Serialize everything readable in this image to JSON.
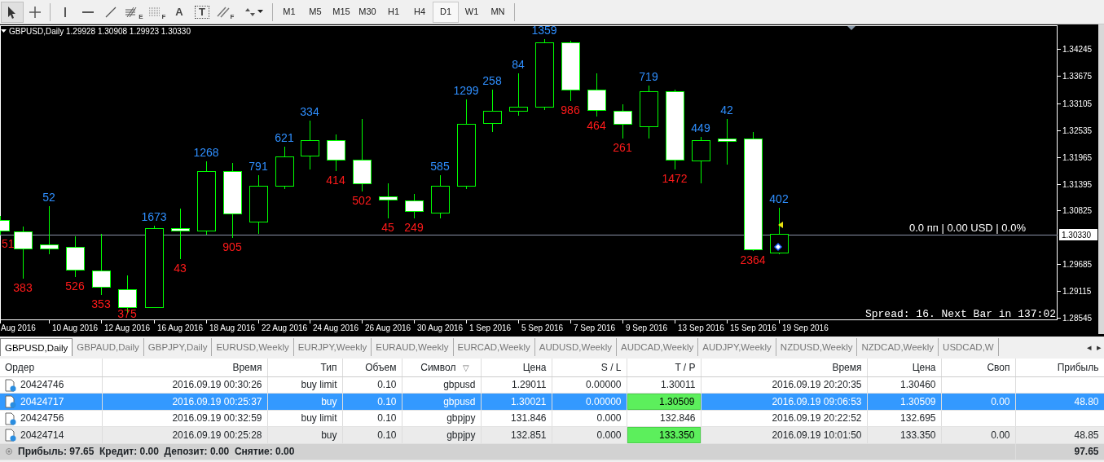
{
  "toolbar": {
    "tools": [
      {
        "kind": "cursor",
        "selected": true
      },
      {
        "kind": "crosshair",
        "selected": false
      },
      {
        "kind": "vline",
        "selected": false
      },
      {
        "kind": "hline",
        "selected": false
      },
      {
        "kind": "trendline",
        "selected": false
      },
      {
        "kind": "fibo",
        "glyph": "E",
        "selected": false
      },
      {
        "kind": "dotted",
        "glyph": "F",
        "selected": false
      },
      {
        "kind": "letter",
        "glyph": "A",
        "selected": false
      },
      {
        "kind": "boxed",
        "glyph": "T",
        "selected": false
      },
      {
        "kind": "parallel",
        "glyph": "F",
        "selected": false
      },
      {
        "kind": "arrows",
        "selected": false
      }
    ],
    "timeframes": [
      {
        "label": "M1",
        "selected": false
      },
      {
        "label": "M5",
        "selected": false
      },
      {
        "label": "M15",
        "selected": false
      },
      {
        "label": "M30",
        "selected": false
      },
      {
        "label": "H1",
        "selected": false
      },
      {
        "label": "H4",
        "selected": false
      },
      {
        "label": "D1",
        "selected": true
      },
      {
        "label": "W1",
        "selected": false
      },
      {
        "label": "MN",
        "selected": false
      }
    ]
  },
  "chart": {
    "symbol": "GBPUSD,Daily",
    "ohlc": "1.29928 1.30908 1.29923 1.30330",
    "candles": [
      {
        "kind": "bear",
        "label": "51",
        "label_above": false,
        "date": "Aug 2016"
      },
      {
        "kind": "bear",
        "label": "383",
        "label_above": false
      },
      {
        "kind": "bear",
        "label": "52",
        "label_above": true,
        "date": "10 Aug 2016"
      },
      {
        "kind": "bear",
        "label": "526",
        "label_above": false
      },
      {
        "kind": "bear",
        "label": "353",
        "label_above": false,
        "date": "12 Aug 2016"
      },
      {
        "kind": "bear",
        "label": "375",
        "label_above": false
      },
      {
        "kind": "bull",
        "label": "1673",
        "label_above": true,
        "date": "16 Aug 2016"
      },
      {
        "kind": "bear",
        "label": "43",
        "label_above": false
      },
      {
        "kind": "bull",
        "label": "1268",
        "label_above": true,
        "date": "18 Aug 2016"
      },
      {
        "kind": "bear",
        "label": "905",
        "label_above": false
      },
      {
        "kind": "bull",
        "label": "791",
        "label_above": true,
        "date": "22 Aug 2016"
      },
      {
        "kind": "bull",
        "label": "621",
        "label_above": true
      },
      {
        "kind": "bull",
        "label": "334",
        "label_above": true,
        "date": "24 Aug 2016"
      },
      {
        "kind": "bear",
        "label": "414",
        "label_above": false
      },
      {
        "kind": "bear",
        "label": "502",
        "label_above": false,
        "date": "26 Aug 2016"
      },
      {
        "kind": "bear",
        "label": "45",
        "label_above": false
      },
      {
        "kind": "bear",
        "label": "249",
        "label_above": false,
        "date": "30 Aug 2016"
      },
      {
        "kind": "bull",
        "label": "585",
        "label_above": true
      },
      {
        "kind": "bull",
        "label": "1299",
        "label_above": true,
        "date": "1 Sep 2016"
      },
      {
        "kind": "bull",
        "label": "258",
        "label_above": true
      },
      {
        "kind": "bull",
        "label": "84",
        "label_above": true,
        "date": "5 Sep 2016"
      },
      {
        "kind": "bull",
        "label": "1359",
        "label_above": true
      },
      {
        "kind": "bear",
        "label": "986",
        "label_above": false,
        "date": "7 Sep 2016"
      },
      {
        "kind": "bear",
        "label": "464",
        "label_above": false
      },
      {
        "kind": "bear",
        "label": "261",
        "label_above": false,
        "date": "9 Sep 2016"
      },
      {
        "kind": "bull",
        "label": "719",
        "label_above": true
      },
      {
        "kind": "bear",
        "label": "1472",
        "label_above": false,
        "date": "13 Sep 2016"
      },
      {
        "kind": "bull",
        "label": "449",
        "label_above": true
      },
      {
        "kind": "bear",
        "label": "42",
        "label_above": true,
        "date": "15 Sep 2016"
      },
      {
        "kind": "bear",
        "label": "2364",
        "label_above": false
      },
      {
        "kind": "bull",
        "label": "402",
        "label_above": true,
        "date": "19 Sep 2016"
      }
    ],
    "price_ticks": [
      "1.34245",
      "1.33675",
      "1.33105",
      "1.32535",
      "1.31965",
      "1.31395",
      "1.30825",
      "1.29685",
      "1.29115",
      "1.28545"
    ],
    "current_price": "1.30330",
    "position_info": "0.0 пп | 0.00 USD | 0.0%",
    "spread_info": "Spread: 16. Next Bar in 137:02"
  },
  "chart_tabs": [
    {
      "label": "GBPUSD,Daily",
      "selected": true
    },
    {
      "label": "GBPAUD,Daily",
      "selected": false
    },
    {
      "label": "GBPJPY,Daily",
      "selected": false
    },
    {
      "label": "EURUSD,Weekly",
      "selected": false
    },
    {
      "label": "EURJPY,Weekly",
      "selected": false
    },
    {
      "label": "EURAUD,Weekly",
      "selected": false
    },
    {
      "label": "EURCAD,Weekly",
      "selected": false
    },
    {
      "label": "AUDUSD,Weekly",
      "selected": false
    },
    {
      "label": "AUDCAD,Weekly",
      "selected": false
    },
    {
      "label": "AUDJPY,Weekly",
      "selected": false
    },
    {
      "label": "NZDUSD,Weekly",
      "selected": false
    },
    {
      "label": "NZDCAD,Weekly",
      "selected": false
    },
    {
      "label": "USDCAD,W",
      "selected": false
    }
  ],
  "tab_scroll": [
    "◂",
    "▸"
  ],
  "table": {
    "columns": [
      {
        "label": "Ордер",
        "right_aligned": false
      },
      {
        "label": "Время",
        "right_aligned": true
      },
      {
        "label": "Тип",
        "right_aligned": true
      },
      {
        "label": "Объем",
        "right_aligned": true
      },
      {
        "label": "Символ",
        "right_aligned": true,
        "sort": "▽"
      },
      {
        "label": "Цена",
        "right_aligned": true
      },
      {
        "label": "S / L",
        "right_aligned": true
      },
      {
        "label": "T / P",
        "right_aligned": true
      },
      {
        "label": "Время",
        "right_aligned": true
      },
      {
        "label": "Цена",
        "right_aligned": true
      },
      {
        "label": "Своп",
        "right_aligned": true
      },
      {
        "label": "Прибыль",
        "right_aligned": true
      }
    ],
    "rows": [
      {
        "selected": false,
        "shaded": false,
        "tp_hit": false,
        "cells": [
          "20424746",
          "2016.09.19 00:30:26",
          "buy limit",
          "0.10",
          "gbpusd",
          "1.29011",
          "0.00000",
          "1.30011",
          "2016.09.19 20:20:35",
          "1.30460",
          "",
          ""
        ]
      },
      {
        "selected": true,
        "shaded": false,
        "tp_hit": true,
        "cells": [
          "20424717",
          "2016.09.19 00:25:37",
          "buy",
          "0.10",
          "gbpusd",
          "1.30021",
          "0.00000",
          "1.30509",
          "2016.09.19 09:06:53",
          "1.30509",
          "0.00",
          "48.80"
        ]
      },
      {
        "selected": false,
        "shaded": false,
        "tp_hit": false,
        "cells": [
          "20424756",
          "2016.09.19 00:32:59",
          "buy limit",
          "0.10",
          "gbpjpy",
          "131.846",
          "0.000",
          "132.846",
          "2016.09.19 20:22:52",
          "132.695",
          "",
          ""
        ]
      },
      {
        "selected": false,
        "shaded": true,
        "tp_hit": true,
        "cells": [
          "20424714",
          "2016.09.19 00:25:28",
          "buy",
          "0.10",
          "gbpjpy",
          "132.851",
          "0.000",
          "133.350",
          "2016.09.19 10:01:50",
          "133.350",
          "0.00",
          "48.85"
        ]
      }
    ],
    "summary": "Прибыль: 97.65  Кредит: 0.00  Депозит: 0.00  Снятие: 0.00",
    "total": "97.65"
  }
}
